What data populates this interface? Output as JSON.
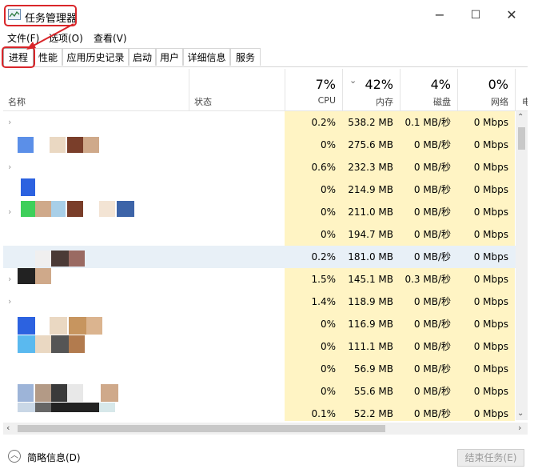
{
  "window": {
    "title": "任务管理器"
  },
  "controls": {
    "minimize": "−",
    "maximize": "☐",
    "close": "✕"
  },
  "menu": {
    "file": "文件(F)",
    "options": "选项(O)",
    "view": "查看(V)"
  },
  "tabs": [
    "进程",
    "性能",
    "应用历史记录",
    "启动",
    "用户",
    "详细信息",
    "服务"
  ],
  "header": {
    "name": "名称",
    "status": "状态",
    "cpu_pct": "7%",
    "cpu_label": "CPU",
    "mem_pct": "42%",
    "mem_label": "内存",
    "disk_pct": "4%",
    "disk_label": "磁盘",
    "net_pct": "0%",
    "net_label": "网络",
    "extra": "电",
    "sort_icon": "chevron-down-icon"
  },
  "rows": [
    {
      "cpu": "0.2%",
      "mem": "538.2 MB",
      "disk": "0.1 MB/秒",
      "net": "0 Mbps"
    },
    {
      "cpu": "0%",
      "mem": "275.6 MB",
      "disk": "0 MB/秒",
      "net": "0 Mbps"
    },
    {
      "cpu": "0.6%",
      "mem": "232.3 MB",
      "disk": "0 MB/秒",
      "net": "0 Mbps"
    },
    {
      "cpu": "0%",
      "mem": "214.9 MB",
      "disk": "0 MB/秒",
      "net": "0 Mbps"
    },
    {
      "cpu": "0%",
      "mem": "211.0 MB",
      "disk": "0 MB/秒",
      "net": "0 Mbps"
    },
    {
      "cpu": "0%",
      "mem": "194.7 MB",
      "disk": "0 MB/秒",
      "net": "0 Mbps"
    },
    {
      "cpu": "0.2%",
      "mem": "181.0 MB",
      "disk": "0 MB/秒",
      "net": "0 Mbps"
    },
    {
      "cpu": "1.5%",
      "mem": "145.1 MB",
      "disk": "0.3 MB/秒",
      "net": "0 Mbps"
    },
    {
      "cpu": "1.4%",
      "mem": "118.9 MB",
      "disk": "0 MB/秒",
      "net": "0 Mbps"
    },
    {
      "cpu": "0%",
      "mem": "116.9 MB",
      "disk": "0 MB/秒",
      "net": "0 Mbps"
    },
    {
      "cpu": "0%",
      "mem": "111.1 MB",
      "disk": "0 MB/秒",
      "net": "0 Mbps"
    },
    {
      "cpu": "0%",
      "mem": "56.9 MB",
      "disk": "0 MB/秒",
      "net": "0 Mbps"
    },
    {
      "cpu": "0%",
      "mem": "55.6 MB",
      "disk": "0 MB/秒",
      "net": "0 Mbps"
    },
    {
      "cpu": "0.1%",
      "mem": "52.2 MB",
      "disk": "0 MB/秒",
      "net": "0 Mbps"
    }
  ],
  "footer": {
    "brief": "简略信息(D)",
    "end_task": "结束任务(E)"
  },
  "colors": {
    "highlight_box": "#d9262a",
    "heat_cell": "#fff4c4",
    "selected_row": "#e8f0f7"
  }
}
